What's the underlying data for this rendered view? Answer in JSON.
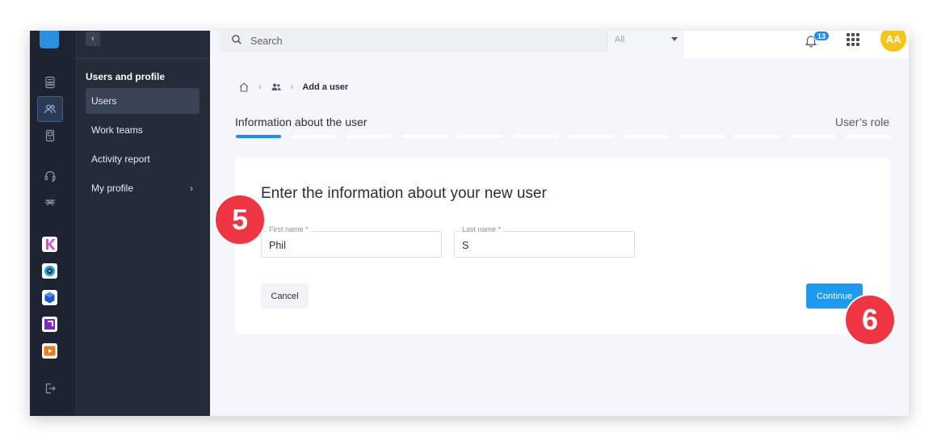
{
  "search": {
    "placeholder": "Search",
    "scope": "All"
  },
  "notifications": {
    "count": "13"
  },
  "user": {
    "initials": "AA"
  },
  "subnav": {
    "heading": "Users and profile",
    "items": [
      {
        "label": "Users"
      },
      {
        "label": "Work teams"
      },
      {
        "label": "Activity report"
      },
      {
        "label": "My profile"
      }
    ]
  },
  "breadcrumb": {
    "current": "Add a user"
  },
  "stepper": {
    "first_step": "Information about the user",
    "last_step": "User’s role"
  },
  "form": {
    "title": "Enter the information about your new user",
    "first_name_label": "First name *",
    "first_name_value": "Phil",
    "last_name_label": "Last name *",
    "last_name_value": "S",
    "cancel_label": "Cancel",
    "continue_label": "Continue"
  },
  "callouts": {
    "first": "5",
    "second": "6"
  },
  "colors": {
    "accent": "#1d9bf0",
    "callout": "#ee3541",
    "sidebar": "#252b39",
    "avatar": "#f5c518"
  }
}
